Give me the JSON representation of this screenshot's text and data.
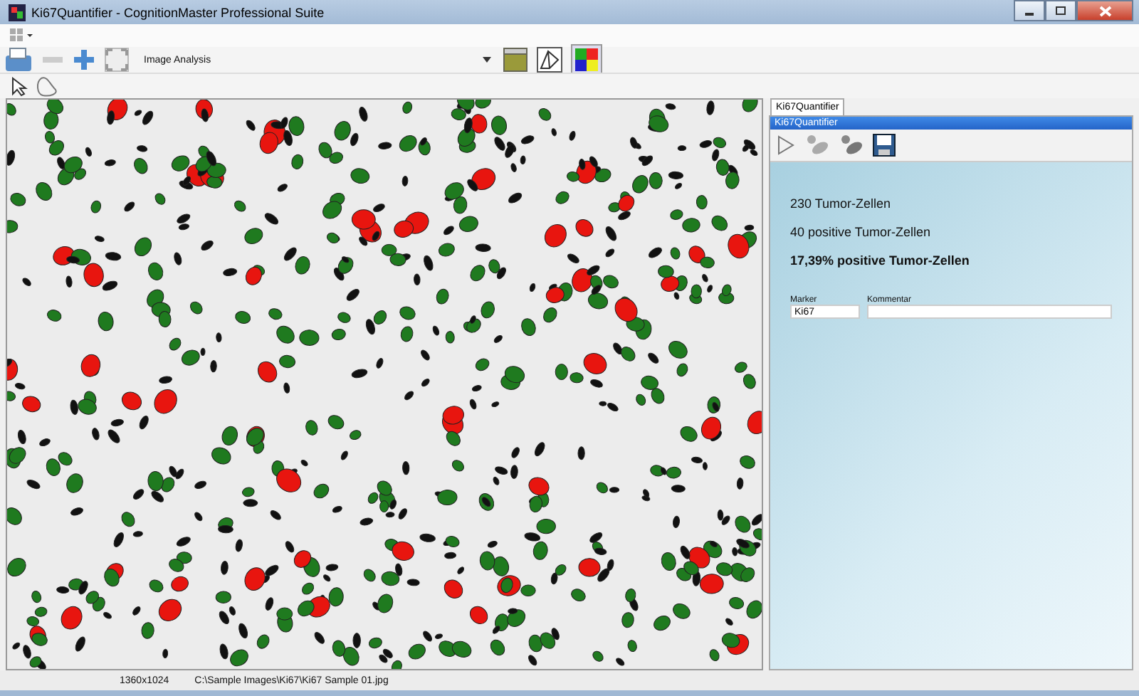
{
  "window": {
    "title": "Ki67Quantifier - CognitionMaster Professional Suite"
  },
  "toolbar": {
    "workflow": "Image Analysis"
  },
  "panel": {
    "tab": "Ki67Quantifier",
    "title": "Ki67Quantifier",
    "results": [
      {
        "text": "230 Tumor-Zellen",
        "bold": false
      },
      {
        "text": "40 positive Tumor-Zellen",
        "bold": false
      },
      {
        "text": "17,39% positive Tumor-Zellen",
        "bold": true
      }
    ],
    "fields": [
      {
        "label": "Marker",
        "value": "Ki67",
        "kind": "short"
      },
      {
        "label": "Kommentar",
        "kind": "wide"
      }
    ]
  },
  "status_bar": {
    "size": "1360x1024",
    "path": "C:\\Sample Images\\Ki67\\Ki67 Sample 01.jpg"
  }
}
